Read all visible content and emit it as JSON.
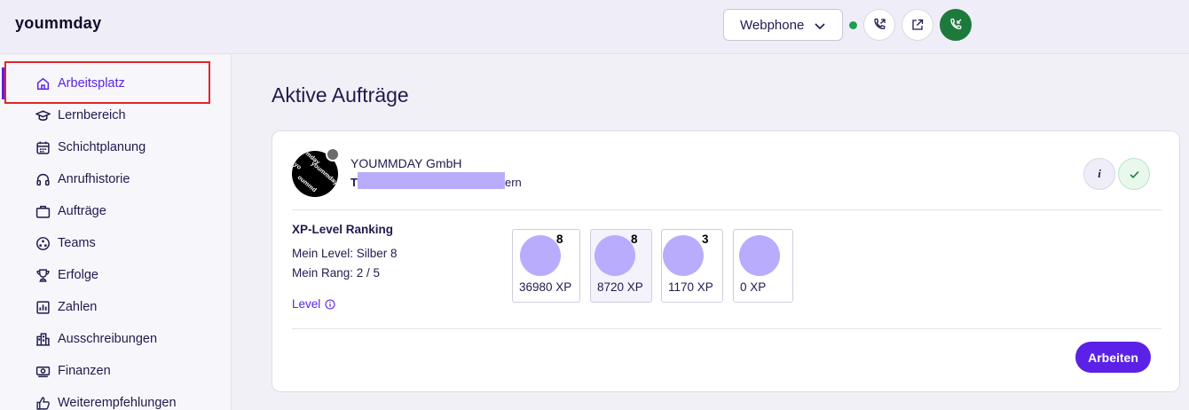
{
  "app": {
    "logo": "yoummday"
  },
  "topbar": {
    "webphone_label": "Webphone",
    "status_color": "#1f9d55",
    "buttons": [
      "phone-forward-icon",
      "external-link-icon",
      "phone-incoming-icon"
    ]
  },
  "sidebar": {
    "items": [
      {
        "label": "Arbeitsplatz",
        "icon": "home-icon",
        "active": true
      },
      {
        "label": "Lernbereich",
        "icon": "graduation-cap-icon"
      },
      {
        "label": "Schichtplanung",
        "icon": "calendar-icon"
      },
      {
        "label": "Anrufhistorie",
        "icon": "headset-icon"
      },
      {
        "label": "Aufträge",
        "icon": "briefcase-icon"
      },
      {
        "label": "Teams",
        "icon": "team-icon"
      },
      {
        "label": "Erfolge",
        "icon": "trophy-icon"
      },
      {
        "label": "Zahlen",
        "icon": "chart-icon"
      },
      {
        "label": "Ausschreibungen",
        "icon": "buildings-icon"
      },
      {
        "label": "Finanzen",
        "icon": "money-icon"
      },
      {
        "label": "Weiterempfehlungen",
        "icon": "thumbs-up-icon"
      }
    ]
  },
  "main": {
    "title": "Aktive Aufträge",
    "card": {
      "company": "YOUMMDAY GmbH",
      "subtitle_start": "T",
      "subtitle_end": "ern",
      "info_label": "i",
      "xp": {
        "title": "XP-Level Ranking",
        "my_level": "Mein Level: Silber 8",
        "my_rank": "Mein Rang: 2 / 5",
        "level_link": "Level"
      },
      "ranking": [
        {
          "level": "8",
          "xp": "36980 XP"
        },
        {
          "level": "8",
          "xp": "8720 XP"
        },
        {
          "level": "3",
          "xp": "1170 XP"
        },
        {
          "level": "",
          "xp": "0 XP"
        }
      ],
      "work_button": "Arbeiten"
    }
  },
  "colors": {
    "accent": "#5b21e6",
    "highlight": "#e0242a",
    "placeholder": "#b9acfc"
  }
}
